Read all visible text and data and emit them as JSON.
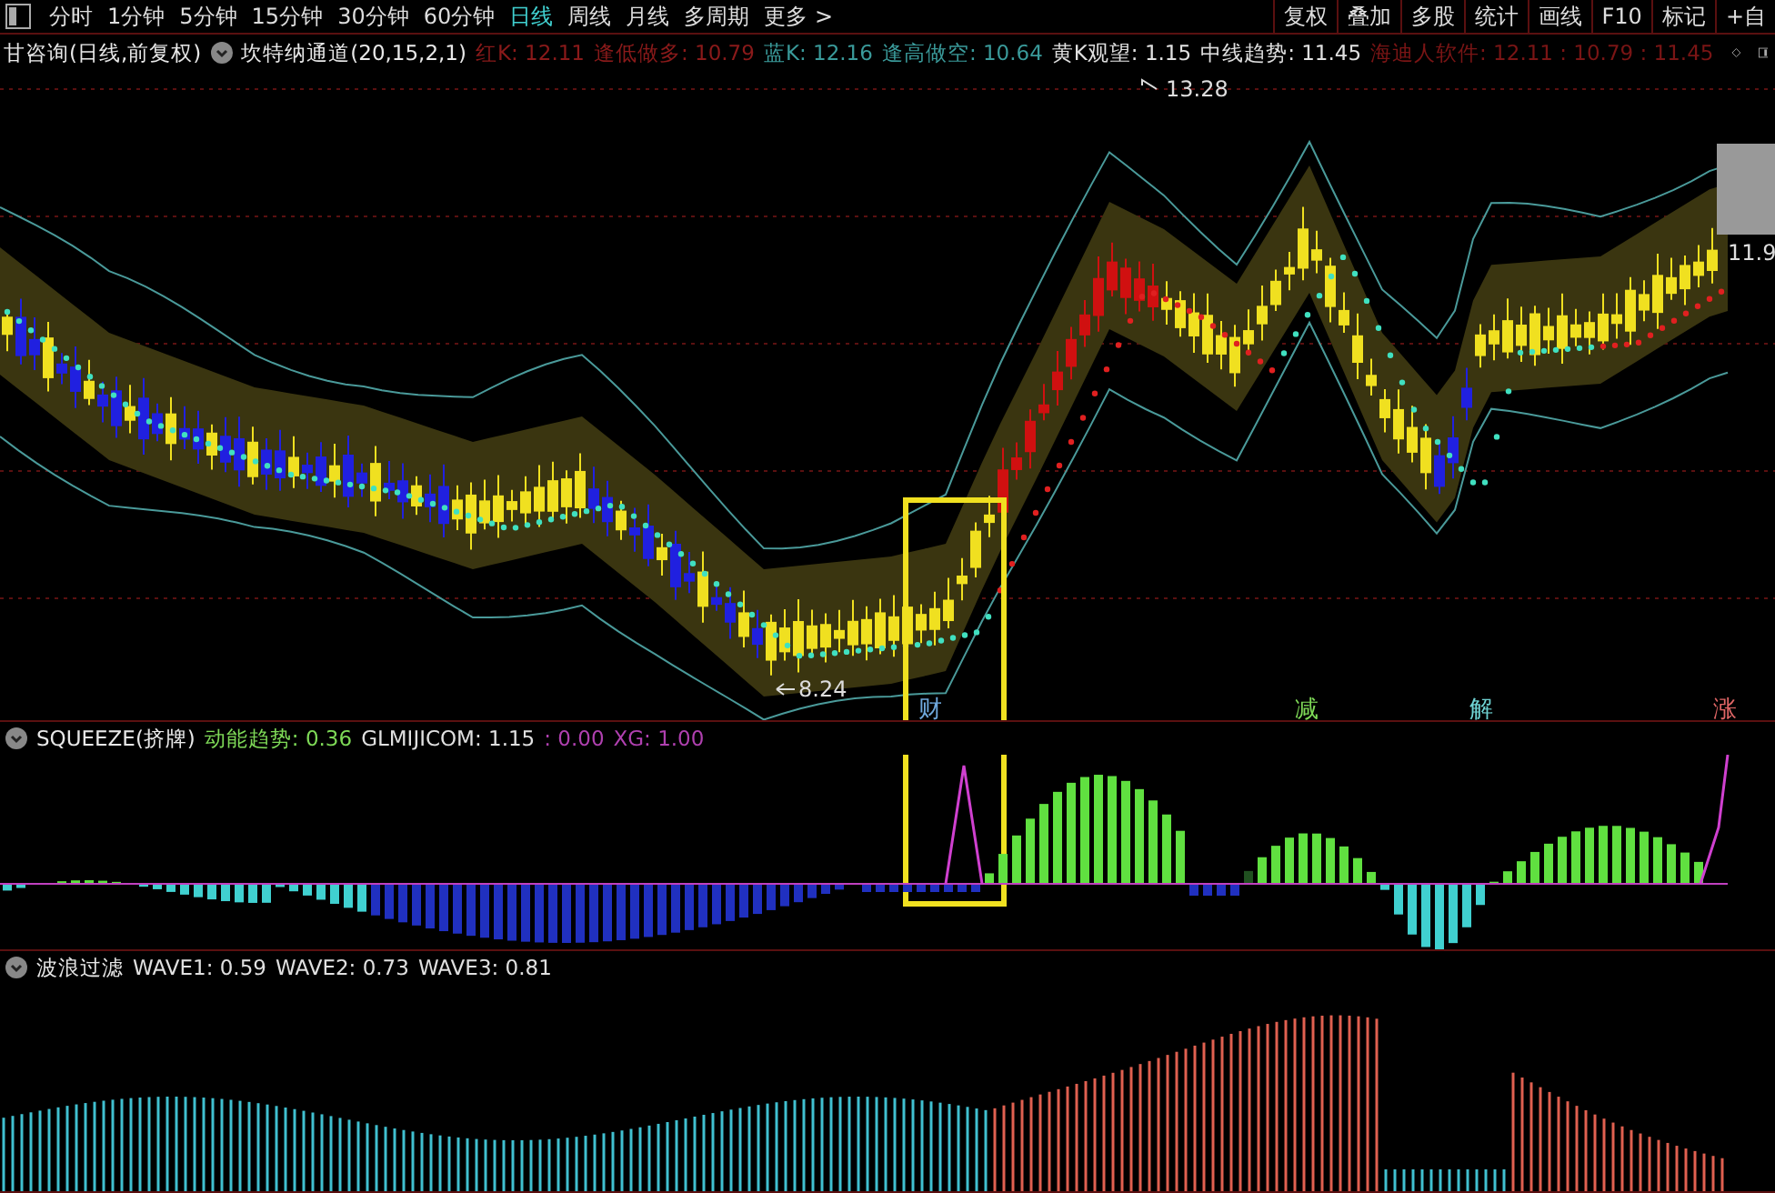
{
  "timeframes": [
    {
      "label": "分时",
      "selected": false
    },
    {
      "label": "1分钟",
      "selected": false
    },
    {
      "label": "5分钟",
      "selected": false
    },
    {
      "label": "15分钟",
      "selected": false
    },
    {
      "label": "30分钟",
      "selected": false
    },
    {
      "label": "60分钟",
      "selected": false
    },
    {
      "label": "日线",
      "selected": true
    },
    {
      "label": "周线",
      "selected": false
    },
    {
      "label": "月线",
      "selected": false
    },
    {
      "label": "多周期",
      "selected": false
    },
    {
      "label": "更多 >",
      "selected": false
    }
  ],
  "toolbar": [
    "复权",
    "叠加",
    "多股",
    "统计",
    "画线",
    "F10",
    "标记",
    "+自"
  ],
  "main_header": {
    "title": "甘咨询(日线,前复权)",
    "indicator": "坎特纳通道(20,15,2,1)",
    "items": [
      {
        "text": "红K: 12.11",
        "color": "#8a1a1a"
      },
      {
        "text": "逢低做多: 10.79",
        "color": "#8a1a1a"
      },
      {
        "text": "蓝K: 12.16",
        "color": "#3a9a9a"
      },
      {
        "text": "逢高做空: 10.64",
        "color": "#3a9a9a"
      },
      {
        "text": "黄K观望: 1.15",
        "color": "#e0e0e0"
      },
      {
        "text": "中线趋势: 11.45",
        "color": "#e0e0e0"
      },
      {
        "text": "海迪人软件: 12.11 : 10.79 : 11.45",
        "color": "#7a1515"
      }
    ]
  },
  "price_marks": [
    "13.28",
    "8.24"
  ],
  "last_price": "11.9",
  "signals": [
    {
      "label": "财",
      "color": "#6fa8dc"
    },
    {
      "label": "减",
      "color": "#7ed957"
    },
    {
      "label": "解",
      "color": "#6fd3d3"
    },
    {
      "label": "涨",
      "color": "#e06666"
    }
  ],
  "squeeze_header": {
    "title": "SQUEEZE(挤牌)",
    "items": [
      {
        "text": "动能趋势: 0.36",
        "color": "#7ed957"
      },
      {
        "text": "GLMIJICOM: 1.15",
        "color": "#e0e0e0"
      },
      {
        "text": ": 0.00",
        "color": "#b040b0"
      },
      {
        "text": "XG: 1.00",
        "color": "#b040b0"
      }
    ]
  },
  "wave_header": {
    "title": "波浪过滤",
    "items": [
      {
        "text": "WAVE1: 0.59",
        "color": "#e0e0e0"
      },
      {
        "text": "WAVE2: 0.73",
        "color": "#e0e0e0"
      },
      {
        "text": "WAVE3: 0.81",
        "color": "#e0e0e0"
      }
    ]
  }
}
